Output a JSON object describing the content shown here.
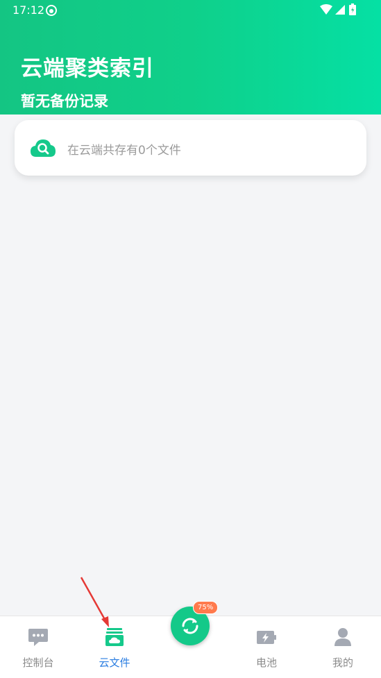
{
  "status_bar": {
    "time": "17:12"
  },
  "header": {
    "title": "云端聚类索引",
    "subtitle": "暂无备份记录"
  },
  "search": {
    "placeholder": "在云端共存有0个文件"
  },
  "sync": {
    "badge": "75%"
  },
  "nav": {
    "items": [
      {
        "label": "控制台",
        "icon": "chat-icon"
      },
      {
        "label": "云文件",
        "icon": "cloud-folder-icon",
        "active": true
      },
      {
        "label": "电池",
        "icon": "battery-charge-icon"
      },
      {
        "label": "我的",
        "icon": "person-icon"
      }
    ]
  },
  "colors": {
    "accent": "#14c583",
    "active_tab": "#2a7de1",
    "inactive_tab": "#8b8b8b",
    "badge": "#ff7a4d",
    "annotation_arrow": "#e53935"
  }
}
